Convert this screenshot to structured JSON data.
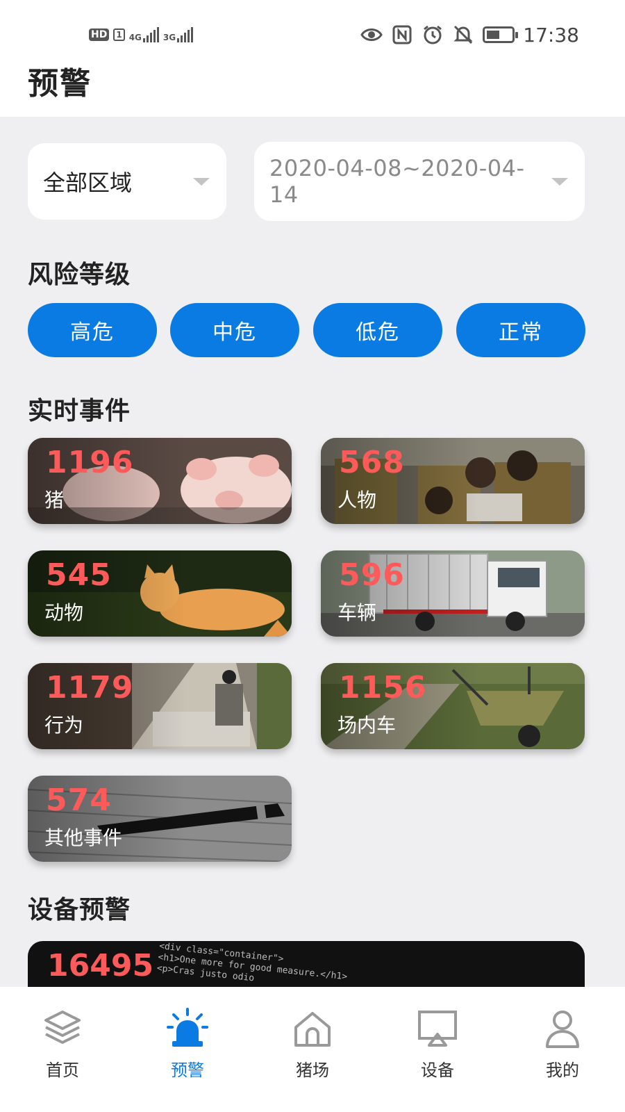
{
  "status_bar": {
    "left_badges": [
      "HD",
      "1"
    ],
    "network_1": "4G",
    "network_2": "3G",
    "time": "17:38",
    "icons": [
      "eye-icon",
      "nfc-icon",
      "alarm-icon",
      "bell-off-icon",
      "battery-icon"
    ]
  },
  "header": {
    "title": "预警"
  },
  "filters": {
    "area": "全部区域",
    "date_range": "2020-04-08~2020-04-14"
  },
  "risk_level": {
    "title": "风险等级",
    "pills": [
      "高危",
      "中危",
      "低危",
      "正常"
    ],
    "color": "#0a7be2"
  },
  "realtime_events": {
    "title": "实时事件",
    "cards": [
      {
        "count": "1196",
        "label": "猪"
      },
      {
        "count": "568",
        "label": "人物"
      },
      {
        "count": "545",
        "label": "动物"
      },
      {
        "count": "596",
        "label": "车辆"
      },
      {
        "count": "1179",
        "label": "行为"
      },
      {
        "count": "1156",
        "label": "场内车"
      },
      {
        "count": "574",
        "label": "其他事件"
      }
    ],
    "count_color": "#ff5a5a"
  },
  "device_warning": {
    "title": "设备预警",
    "count": "16495",
    "code_lines": [
      "<div class=\"container\">",
      "<h1>One more for good measure.</h1>",
      "<p>Cras justo odio"
    ]
  },
  "tabbar": {
    "tabs": [
      {
        "label": "首页",
        "icon": "layers-icon"
      },
      {
        "label": "预警",
        "icon": "siren-icon"
      },
      {
        "label": "猪场",
        "icon": "home-icon"
      },
      {
        "label": "设备",
        "icon": "monitor-icon"
      },
      {
        "label": "我的",
        "icon": "user-icon"
      }
    ],
    "active_index": 1
  }
}
